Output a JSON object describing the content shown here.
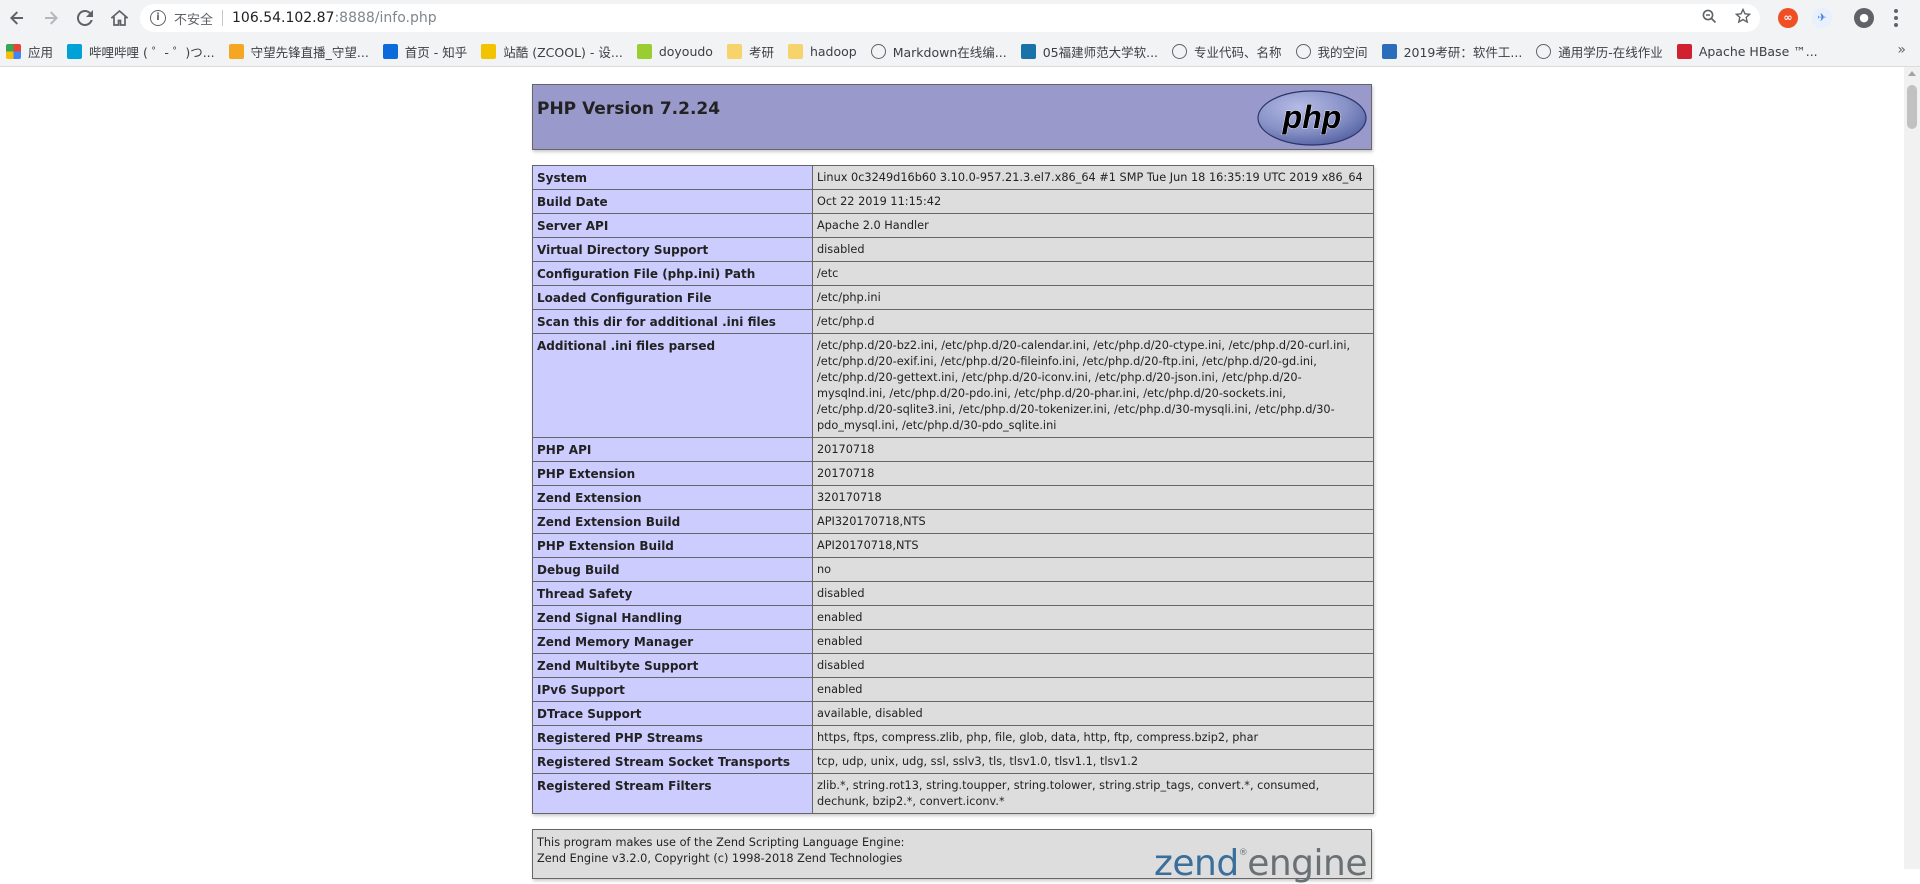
{
  "browser": {
    "omnibox": {
      "security_label": "不安全",
      "host": "106.54.102.87",
      "path": ":8888/info.php"
    },
    "bookmarks": [
      {
        "label": "应用",
        "icon": "apps-grid-icon",
        "color": "#e94235"
      },
      {
        "label": "哔哩哔哩 ( ゜- ゜)つ...",
        "icon": "bilibili-icon",
        "color": "#00a1d6"
      },
      {
        "label": "守望先锋直播_守望...",
        "icon": "huya-icon",
        "color": "#f5a623"
      },
      {
        "label": "首页 - 知乎",
        "icon": "zhihu-icon",
        "color": "#0b6bdb"
      },
      {
        "label": "站酷 (ZCOOL) - 设...",
        "icon": "zcool-icon",
        "color": "#f2c300"
      },
      {
        "label": "doyoudo",
        "icon": "doyoudo-icon",
        "color": "#9acd32"
      },
      {
        "label": "考研",
        "icon": "folder-icon",
        "color": "#f6d36b"
      },
      {
        "label": "hadoop",
        "icon": "folder-icon",
        "color": "#f6d36b"
      },
      {
        "label": "Markdown在线编...",
        "icon": "globe-icon",
        "color": "#5f6368"
      },
      {
        "label": "05福建师范大学软...",
        "icon": "site-icon",
        "color": "#1a73a8"
      },
      {
        "label": "专业代码、名称",
        "icon": "globe-icon",
        "color": "#5f6368"
      },
      {
        "label": "我的空间",
        "icon": "globe-icon",
        "color": "#5f6368"
      },
      {
        "label": "2019考研：软件工...",
        "icon": "k-icon",
        "color": "#2a6ebb"
      },
      {
        "label": "通用学历-在线作业",
        "icon": "globe-icon",
        "color": "#5f6368"
      },
      {
        "label": "Apache HBase ™...",
        "icon": "hbase-icon",
        "color": "#d1202f"
      }
    ]
  },
  "phpinfo": {
    "title": "PHP Version 7.2.24",
    "logo_text": "php",
    "rows": [
      {
        "key": "System",
        "value": "Linux 0c3249d16b60 3.10.0-957.21.3.el7.x86_64 #1 SMP Tue Jun 18 16:35:19 UTC 2019 x86_64"
      },
      {
        "key": "Build Date",
        "value": "Oct 22 2019 11:15:42"
      },
      {
        "key": "Server API",
        "value": "Apache 2.0 Handler"
      },
      {
        "key": "Virtual Directory Support",
        "value": "disabled"
      },
      {
        "key": "Configuration File (php.ini) Path",
        "value": "/etc"
      },
      {
        "key": "Loaded Configuration File",
        "value": "/etc/php.ini"
      },
      {
        "key": "Scan this dir for additional .ini files",
        "value": "/etc/php.d"
      },
      {
        "key": "Additional .ini files parsed",
        "value": "/etc/php.d/20-bz2.ini, /etc/php.d/20-calendar.ini, /etc/php.d/20-ctype.ini, /etc/php.d/20-curl.ini, /etc/php.d/20-exif.ini, /etc/php.d/20-fileinfo.ini, /etc/php.d/20-ftp.ini, /etc/php.d/20-gd.ini, /etc/php.d/20-gettext.ini, /etc/php.d/20-iconv.ini, /etc/php.d/20-json.ini, /etc/php.d/20-mysqlnd.ini, /etc/php.d/20-pdo.ini, /etc/php.d/20-phar.ini, /etc/php.d/20-sockets.ini, /etc/php.d/20-sqlite3.ini, /etc/php.d/20-tokenizer.ini, /etc/php.d/30-mysqli.ini, /etc/php.d/30-pdo_mysql.ini, /etc/php.d/30-pdo_sqlite.ini"
      },
      {
        "key": "PHP API",
        "value": "20170718"
      },
      {
        "key": "PHP Extension",
        "value": "20170718"
      },
      {
        "key": "Zend Extension",
        "value": "320170718"
      },
      {
        "key": "Zend Extension Build",
        "value": "API320170718,NTS"
      },
      {
        "key": "PHP Extension Build",
        "value": "API20170718,NTS"
      },
      {
        "key": "Debug Build",
        "value": "no"
      },
      {
        "key": "Thread Safety",
        "value": "disabled"
      },
      {
        "key": "Zend Signal Handling",
        "value": "enabled"
      },
      {
        "key": "Zend Memory Manager",
        "value": "enabled"
      },
      {
        "key": "Zend Multibyte Support",
        "value": "disabled"
      },
      {
        "key": "IPv6 Support",
        "value": "enabled"
      },
      {
        "key": "DTrace Support",
        "value": "available, disabled"
      },
      {
        "key": "Registered PHP Streams",
        "value": "https, ftps, compress.zlib, php, file, glob, data, http, ftp, compress.bzip2, phar"
      },
      {
        "key": "Registered Stream Socket Transports",
        "value": "tcp, udp, unix, udg, ssl, sslv3, tls, tlsv1.0, tlsv1.1, tlsv1.2"
      },
      {
        "key": "Registered Stream Filters",
        "value": "zlib.*, string.rot13, string.toupper, string.tolower, string.strip_tags, convert.*, consumed, dechunk, bzip2.*, convert.iconv.*"
      }
    ],
    "zend": {
      "line1": "This program makes use of the Zend Scripting Language Engine:",
      "line2": "Zend Engine v3.2.0, Copyright (c) 1998-2018 Zend Technologies",
      "logo_part1": "zend",
      "logo_part2": "engine",
      "logo_mark": "®"
    }
  }
}
